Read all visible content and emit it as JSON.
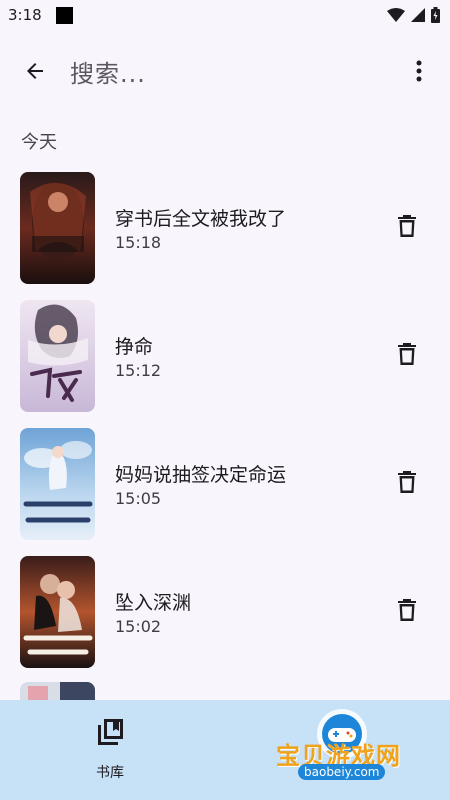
{
  "status_bar": {
    "time": "3:18"
  },
  "search": {
    "query": "搜索..."
  },
  "section": {
    "label": "今天"
  },
  "history": [
    {
      "title": "穿书后全文被我改了",
      "time": "15:18",
      "cover_text": "穿书后全文被我改了"
    },
    {
      "title": "挣命",
      "time": "15:12",
      "cover_text": "挣命"
    },
    {
      "title": "妈妈说抽签决定命运",
      "time": "15:05",
      "cover_text": "妈妈说抽签决定命运"
    },
    {
      "title": "坠入深渊",
      "time": "15:02",
      "cover_text": "坠入深渊"
    }
  ],
  "bottom_nav": {
    "library_label": "书库"
  },
  "watermark": {
    "text": "宝贝游戏网",
    "domain": "baobeiy.com"
  },
  "colors": {
    "background": "#f8f6fc",
    "bottom_nav": "#c7e1f7",
    "watermark_orange": "#f0a21a",
    "watermark_blue": "#1e86d8"
  },
  "icons": [
    "back-arrow-icon",
    "more-vert-icon",
    "delete-icon",
    "library-icon",
    "wifi-icon",
    "signal-icon",
    "battery-icon"
  ]
}
